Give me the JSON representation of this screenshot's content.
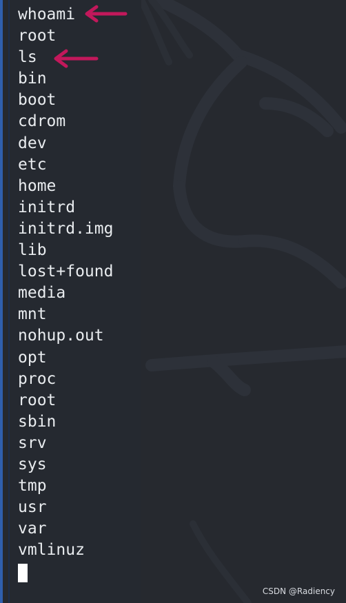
{
  "terminal": {
    "lines": [
      {
        "text": "whoami",
        "kind": "command"
      },
      {
        "text": "root",
        "kind": "output"
      },
      {
        "text": "ls",
        "kind": "command"
      },
      {
        "text": "bin",
        "kind": "output"
      },
      {
        "text": "boot",
        "kind": "output"
      },
      {
        "text": "cdrom",
        "kind": "output"
      },
      {
        "text": "dev",
        "kind": "output"
      },
      {
        "text": "etc",
        "kind": "output"
      },
      {
        "text": "home",
        "kind": "output"
      },
      {
        "text": "initrd",
        "kind": "output"
      },
      {
        "text": "initrd.img",
        "kind": "output"
      },
      {
        "text": "lib",
        "kind": "output"
      },
      {
        "text": "lost+found",
        "kind": "output"
      },
      {
        "text": "media",
        "kind": "output"
      },
      {
        "text": "mnt",
        "kind": "output"
      },
      {
        "text": "nohup.out",
        "kind": "output"
      },
      {
        "text": "opt",
        "kind": "output"
      },
      {
        "text": "proc",
        "kind": "output"
      },
      {
        "text": "root",
        "kind": "output"
      },
      {
        "text": "sbin",
        "kind": "output"
      },
      {
        "text": "srv",
        "kind": "output"
      },
      {
        "text": "sys",
        "kind": "output"
      },
      {
        "text": "tmp",
        "kind": "output"
      },
      {
        "text": "usr",
        "kind": "output"
      },
      {
        "text": "var",
        "kind": "output"
      },
      {
        "text": "vmlinuz",
        "kind": "output"
      }
    ],
    "cursor": "block-cursor"
  },
  "annotations": {
    "arrow_color": "#c2185b",
    "arrows": [
      {
        "icon": "arrow-left-icon",
        "points_to": "whoami"
      },
      {
        "icon": "arrow-left-icon",
        "points_to": "ls"
      }
    ]
  },
  "colors": {
    "terminal_bg": "#26292f",
    "terminal_text": "#e9ecef",
    "accent": "#2f5fae"
  },
  "watermark": "CSDN @Radiency"
}
